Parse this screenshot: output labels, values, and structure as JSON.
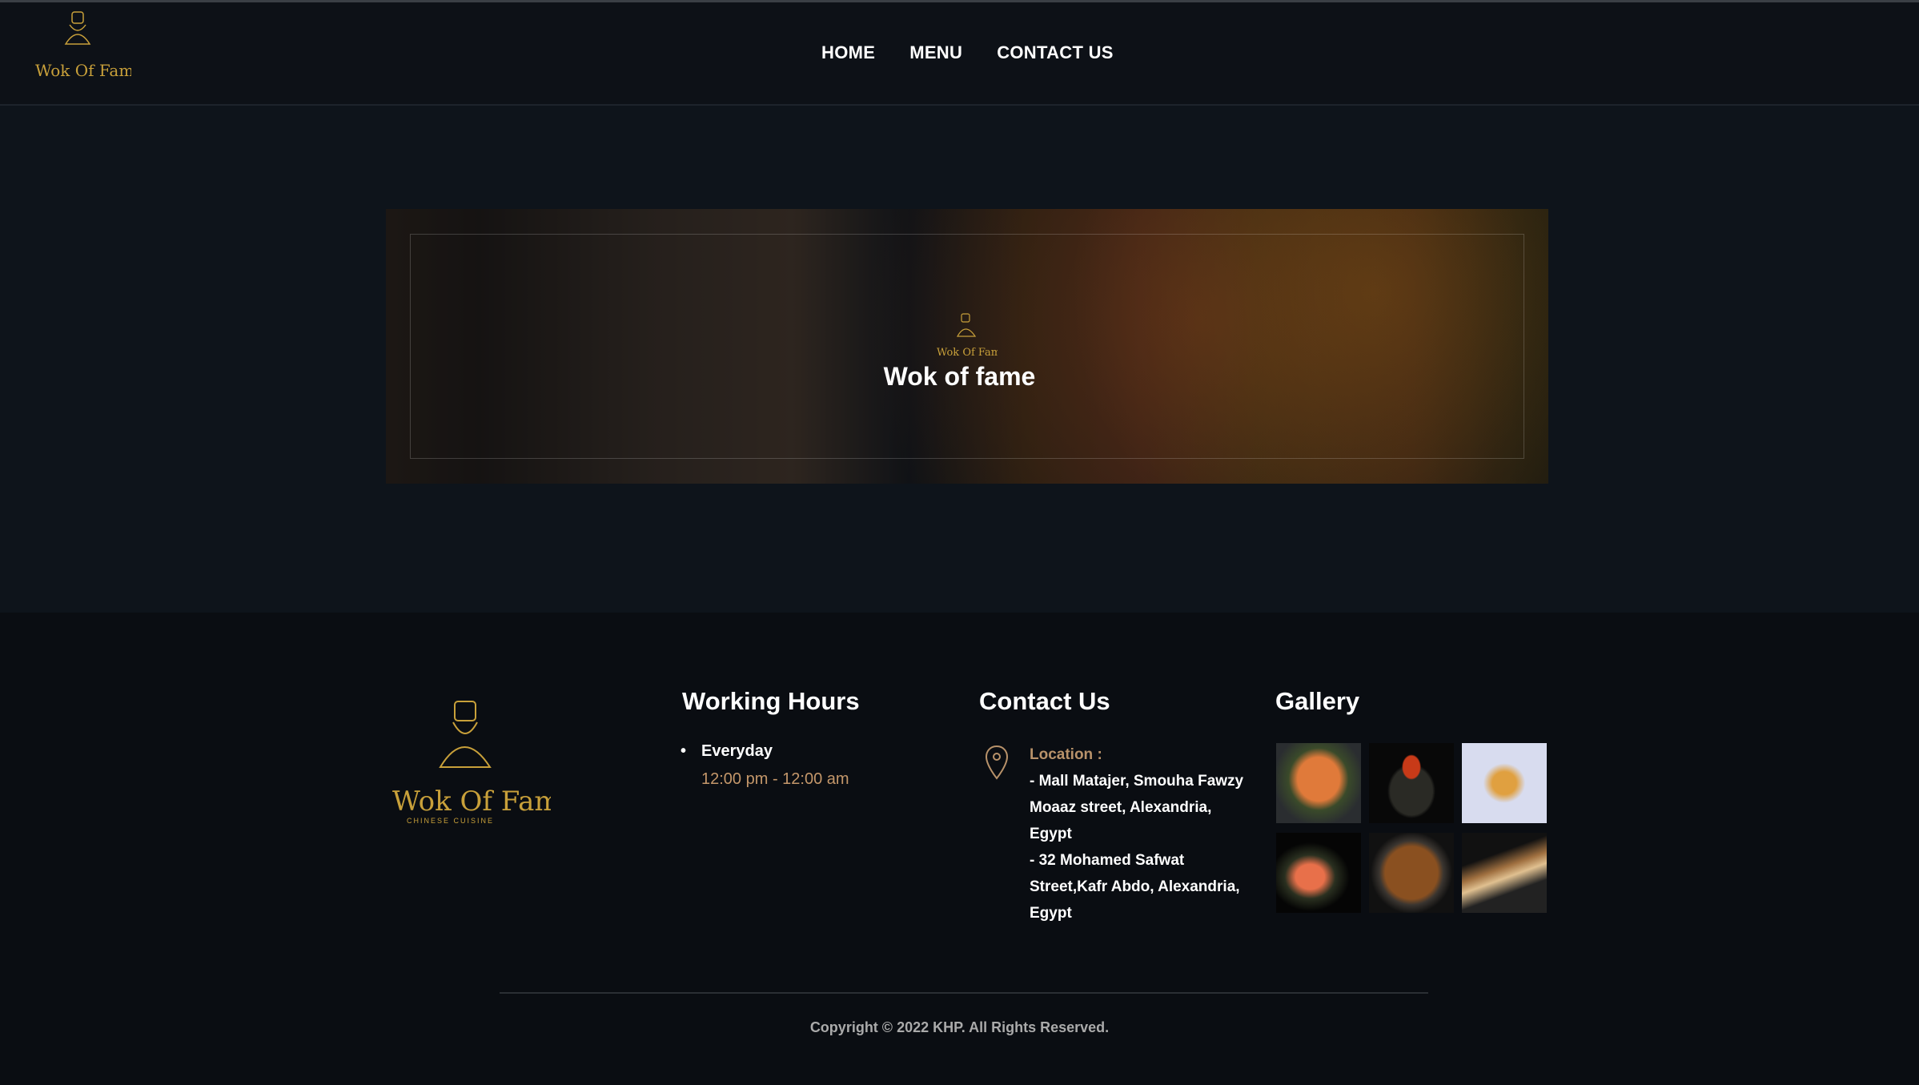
{
  "header": {
    "logo_text": "Wok Of Fame",
    "nav": [
      "HOME",
      "MENU",
      "CONTACT US"
    ]
  },
  "hero": {
    "title": "Wok of fame"
  },
  "footer": {
    "logo_text": "Wok Of Fame Chinese Cuisine",
    "working_hours": {
      "title": "Working Hours",
      "day": "Everyday",
      "time": "12:00 pm - 12:00 am"
    },
    "contact": {
      "title": "Contact Us",
      "location_label": "Location :",
      "address_1": "- Mall Matajer, Smouha Fawzy Moaaz street, Alexandria, Egypt",
      "address_2": "- 32 Mohamed Safwat Street,Kafr Abdo, Alexandria, Egypt"
    },
    "gallery": {
      "title": "Gallery",
      "images": [
        "salmon-nigiri",
        "ikura-gunkan",
        "fried-shrimp",
        "salmon-temaki",
        "noodles",
        "sushi-roll"
      ]
    },
    "copyright": "Copyright © 2022 KHP. All Rights Reserved."
  },
  "colors": {
    "accent_gold": "#c8a03a",
    "accent_tan": "#c4976a",
    "background": "#0e141b"
  }
}
